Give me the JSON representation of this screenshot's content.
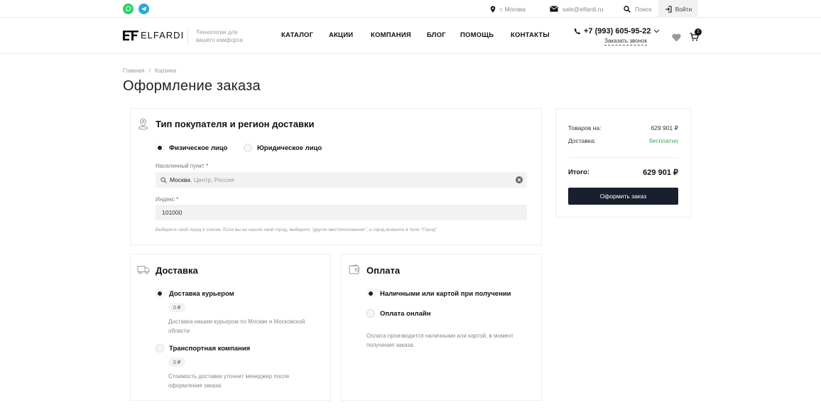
{
  "topbar": {
    "city": "г. Москва",
    "email": "sale@elfardi.ru",
    "search": "Поиск",
    "login": "Войти"
  },
  "header": {
    "logo": "ELFARDI",
    "tagline": "Технологии для вашего комфорта",
    "nav": [
      "КАТАЛОГ",
      "АКЦИИ",
      "КОМПАНИЯ",
      "БЛОГ",
      "ПОМОЩЬ",
      "КОНТАКТЫ"
    ],
    "phone": "+7 (993) 605-95-22",
    "callback": "Заказать звонок",
    "cart_count": "2"
  },
  "breadcrumb": {
    "home": "Главная",
    "sep": "/",
    "current": "Корзина"
  },
  "page_title": "Оформление заказа",
  "buyer": {
    "title": "Тип покупателя и регион доставки",
    "types": [
      "Физическое лицо",
      "Юридическое лицо"
    ],
    "selected_type": "Физическое лицо",
    "city_label": "Населенный пункт",
    "city_value": "Москва",
    "city_suffix": ", Центр, Россия",
    "index_label": "Индекс",
    "index_value": "101000",
    "required_mark": "*",
    "hint": "Выберите свой город в списке. Если вы не нашли свой город, выберите \"другое местоположение\", а город впишите в поле \"Город\""
  },
  "delivery": {
    "title": "Доставка",
    "options": [
      {
        "label": "Доставка курьером",
        "price": "0 ₽",
        "desc": "Доставка нашим курьером по Москве и Московской области",
        "selected": true
      },
      {
        "label": "Транспортная компания",
        "price": "0 ₽",
        "desc": "Стоимость доставки уточнит менеджер после оформления заказа",
        "selected": false
      }
    ]
  },
  "payment": {
    "title": "Оплата",
    "options": [
      {
        "label": "Наличными или картой при получении",
        "selected": true
      },
      {
        "label": "Оплата онлайн",
        "selected": false
      }
    ],
    "desc": "Оплата производится наличными или картой, в момент получения заказа."
  },
  "summary": {
    "goods_label": "Товаров на:",
    "goods_value": "629 901 ₽",
    "delivery_label": "Доставка:",
    "delivery_value": "бесплатно",
    "total_label": "Итого:",
    "total_value": "629 901 ₽",
    "button": "Оформить заказ"
  },
  "colors": {
    "accent": "#1a1f2e",
    "free": "#3aa35a",
    "required": "#e03030"
  }
}
